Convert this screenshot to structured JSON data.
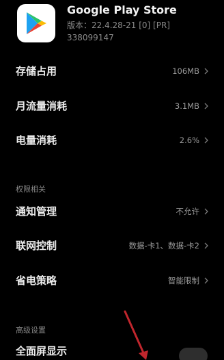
{
  "app": {
    "name": "Google Play Store",
    "version": "版本：22.4.28-21 [0] [PR] 338099147",
    "icon": "google-play-icon"
  },
  "rows": {
    "storage": {
      "label": "存储占用",
      "value": "106MB"
    },
    "data": {
      "label": "月流量消耗",
      "value": "3.1MB"
    },
    "battery": {
      "label": "电量消耗",
      "value": "2.6%"
    },
    "notifications": {
      "label": "通知管理",
      "value": "不允许"
    },
    "network": {
      "label": "联网控制",
      "value": "数据-卡1、数据-卡2"
    },
    "power": {
      "label": "省电策略",
      "value": "智能限制"
    },
    "fullscreen": {
      "label": "全面屏显示"
    }
  },
  "sections": {
    "permissions": "权限相关",
    "advanced": "高级设置"
  },
  "colors": {
    "background": "#000000",
    "annotation_arrow": "#c0262d"
  }
}
